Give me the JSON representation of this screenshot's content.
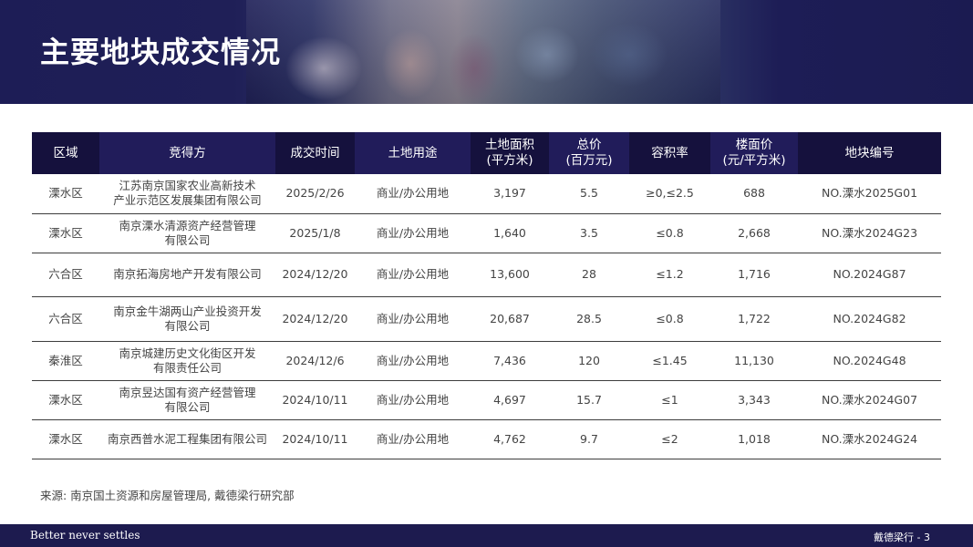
{
  "header": {
    "title": "主要地块成交情况"
  },
  "table": {
    "columns": [
      {
        "label": "区域",
        "sub": ""
      },
      {
        "label": "竞得方",
        "sub": ""
      },
      {
        "label": "成交时间",
        "sub": ""
      },
      {
        "label": "土地用途",
        "sub": ""
      },
      {
        "label": "土地面积",
        "sub": "(平方米)"
      },
      {
        "label": "总价",
        "sub": "(百万元)"
      },
      {
        "label": "容积率",
        "sub": ""
      },
      {
        "label": "楼面价",
        "sub": "(元/平方米)"
      },
      {
        "label": "地块编号",
        "sub": ""
      }
    ],
    "rows": [
      {
        "district": "溧水区",
        "buyer": [
          "江苏南京国家农业高新技术",
          "产业示范区发展集团有限公司"
        ],
        "date": "2025/2/26",
        "use": "商业/办公用地",
        "area": "3,197",
        "price": "5.5",
        "far": "≥0,≤2.5",
        "floor_price": "688",
        "plot_no": "NO.溧水2025G01"
      },
      {
        "district": "溧水区",
        "buyer": [
          "南京溧水清源资产经营管理",
          "有限公司"
        ],
        "date": "2025/1/8",
        "use": "商业/办公用地",
        "area": "1,640",
        "price": "3.5",
        "far": "≤0.8",
        "floor_price": "2,668",
        "plot_no": "NO.溧水2024G23"
      },
      {
        "district": "六合区",
        "buyer": [
          "南京拓海房地产开发有限公司",
          ""
        ],
        "date": "2024/12/20",
        "use": "商业/办公用地",
        "area": "13,600",
        "price": "28",
        "far": "≤1.2",
        "floor_price": "1,716",
        "plot_no": "NO.2024G87"
      },
      {
        "district": "六合区",
        "buyer": [
          "南京金牛湖两山产业投资开发",
          "有限公司"
        ],
        "date": "2024/12/20",
        "use": "商业/办公用地",
        "area": "20,687",
        "price": "28.5",
        "far": "≤0.8",
        "floor_price": "1,722",
        "plot_no": "NO.2024G82"
      },
      {
        "district": "秦淮区",
        "buyer": [
          "南京城建历史文化街区开发",
          "有限责任公司"
        ],
        "date": "2024/12/6",
        "use": "商业/办公用地",
        "area": "7,436",
        "price": "120",
        "far": "≤1.45",
        "floor_price": "11,130",
        "plot_no": "NO.2024G48"
      },
      {
        "district": "溧水区",
        "buyer": [
          "南京昱达国有资产经营管理",
          "有限公司"
        ],
        "date": "2024/10/11",
        "use": "商业/办公用地",
        "area": "4,697",
        "price": "15.7",
        "far": "≤1",
        "floor_price": "3,343",
        "plot_no": "NO.溧水2024G07"
      },
      {
        "district": "溧水区",
        "buyer": [
          "南京西普水泥工程集团有限公司",
          ""
        ],
        "date": "2024/10/11",
        "use": "商业/办公用地",
        "area": "4,762",
        "price": "9.7",
        "far": "≤2",
        "floor_price": "1,018",
        "plot_no": "NO.溧水2024G24"
      }
    ]
  },
  "source": "来源: 南京国土资源和房屋管理局, 戴德梁行研究部",
  "footer": {
    "slogan": "Better never settles",
    "page_ref": "戴德梁行 - 3"
  },
  "colors": {
    "brand_navy": "#1d1b4f",
    "header_cell": "#211c5a",
    "header_cell_dark": "#15113d"
  }
}
